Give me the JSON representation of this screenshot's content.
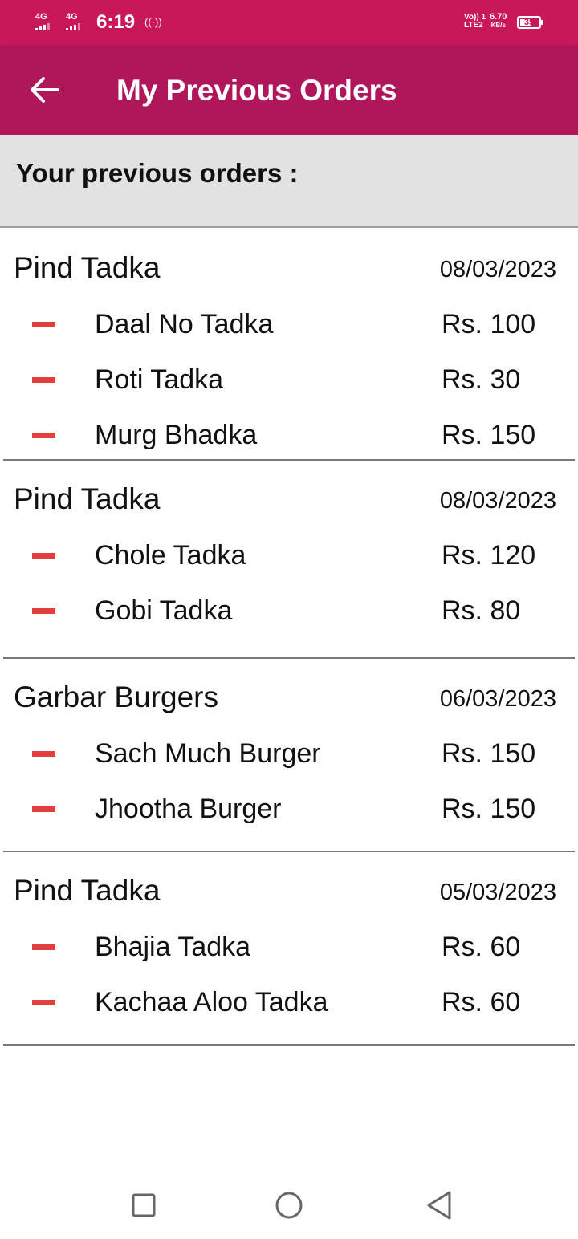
{
  "status_bar": {
    "sim1_net": "4G",
    "sim2_net": "4G",
    "time": "6:19",
    "hotspot_icon": "hotspot-icon",
    "volte_line1": "Vo)) 1",
    "volte_line2": "LTE2",
    "speed_value": "6.70",
    "speed_unit": "KB/s",
    "battery_level": "35"
  },
  "app_bar": {
    "back_icon": "back-arrow-icon",
    "title": "My Previous Orders"
  },
  "subheader": {
    "title": "Your previous orders :"
  },
  "orders": [
    {
      "restaurant": "Pind Tadka",
      "date": "08/03/2023",
      "items": [
        {
          "name": "Daal No Tadka",
          "price": "Rs. 100"
        },
        {
          "name": "Roti Tadka",
          "price": "Rs. 30"
        },
        {
          "name": "Murg Bhadka",
          "price": "Rs. 150"
        }
      ]
    },
    {
      "restaurant": "Pind Tadka",
      "date": "08/03/2023",
      "items": [
        {
          "name": "Chole Tadka",
          "price": "Rs. 120"
        },
        {
          "name": "Gobi Tadka",
          "price": "Rs. 80"
        }
      ]
    },
    {
      "restaurant": "Garbar Burgers",
      "date": "06/03/2023",
      "items": [
        {
          "name": "Sach Much Burger",
          "price": "Rs. 150"
        },
        {
          "name": "Jhootha Burger",
          "price": "Rs. 150"
        }
      ]
    },
    {
      "restaurant": "Pind Tadka",
      "date": "05/03/2023",
      "items": [
        {
          "name": "Bhajia Tadka",
          "price": "Rs. 60"
        },
        {
          "name": "Kachaa Aloo Tadka",
          "price": "Rs. 60"
        }
      ]
    }
  ],
  "nav_bar": {
    "recents_icon": "recents-square-icon",
    "home_icon": "home-circle-icon",
    "back_icon": "back-triangle-icon"
  },
  "colors": {
    "status_bar": "#c8185a",
    "app_bar": "#b0175a",
    "subheader_bg": "#e2e2e2",
    "bullet": "#e23e3e"
  }
}
